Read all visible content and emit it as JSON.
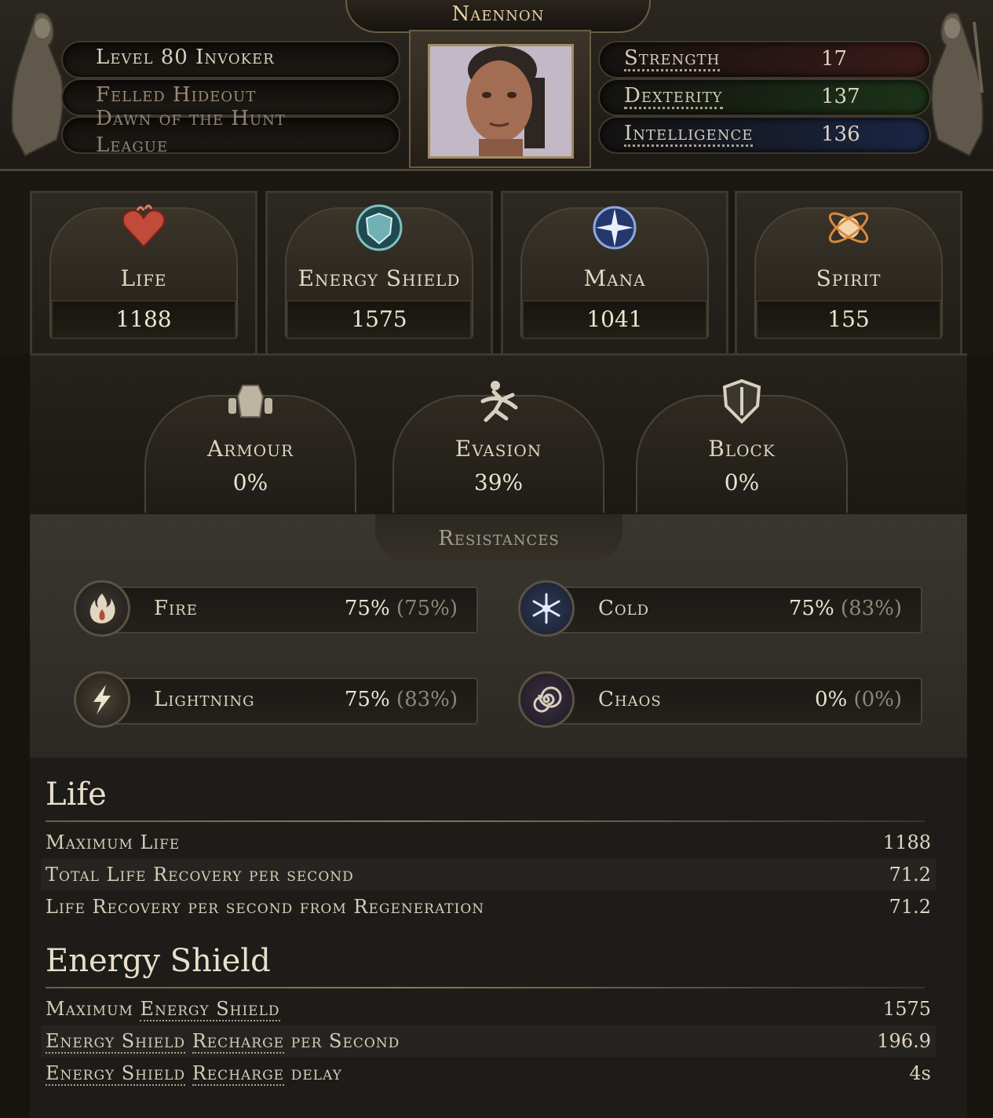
{
  "character": {
    "name": "Naennon",
    "level_line": "Level 80 Invoker",
    "location": "Felled Hideout",
    "league_name": "Dawn of the Hunt",
    "league_label": "League"
  },
  "attributes": [
    {
      "label": "Strength",
      "value": "17",
      "color": "#b54848"
    },
    {
      "label": "Dexterity",
      "value": "137",
      "color": "#3f8f3a"
    },
    {
      "label": "Intelligence",
      "value": "136",
      "color": "#3a5fae"
    }
  ],
  "primary": [
    {
      "label": "Life",
      "value": "1188",
      "icon": "heart-icon"
    },
    {
      "label": "Energy Shield",
      "value": "1575",
      "icon": "energy-shield-icon"
    },
    {
      "label": "Mana",
      "value": "1041",
      "icon": "mana-icon"
    },
    {
      "label": "Spirit",
      "value": "155",
      "icon": "spirit-icon"
    }
  ],
  "defences": [
    {
      "label": "Armour",
      "value": "0%",
      "icon": "armour-icon"
    },
    {
      "label": "Evasion",
      "value": "39%",
      "icon": "evasion-icon"
    },
    {
      "label": "Block",
      "value": "0%",
      "icon": "shield-icon"
    }
  ],
  "resistances": {
    "title": "Resistances",
    "items": [
      {
        "label": "Fire",
        "value": "75%",
        "max": "(75%)",
        "icon": "fire-icon"
      },
      {
        "label": "Cold",
        "value": "75%",
        "max": "(83%)",
        "icon": "snowflake-icon"
      },
      {
        "label": "Lightning",
        "value": "75%",
        "max": "(83%)",
        "icon": "lightning-icon"
      },
      {
        "label": "Chaos",
        "value": "0%",
        "max": "(0%)",
        "icon": "chaos-spiral-icon"
      }
    ]
  },
  "details": {
    "life": {
      "title": "Life",
      "rows": [
        {
          "label": "Maximum Life",
          "value": "1188"
        },
        {
          "label": "Total Life Recovery per second",
          "value": "71.2"
        },
        {
          "label": "Life Recovery per second from Regeneration",
          "value": "71.2"
        }
      ]
    },
    "energy_shield": {
      "title": "Energy Shield",
      "rows": [
        {
          "prefix": "Maximum ",
          "label_a": "Energy Shield",
          "label_b": "",
          "suffix": "",
          "value": "1575"
        },
        {
          "prefix": "",
          "label_a": "Energy Shield",
          "label_b": "Recharge",
          "suffix": " per Second",
          "value": "196.9"
        },
        {
          "prefix": "",
          "label_a": "Energy Shield",
          "label_b": "Recharge",
          "suffix": " delay",
          "value": "4s"
        }
      ]
    }
  }
}
